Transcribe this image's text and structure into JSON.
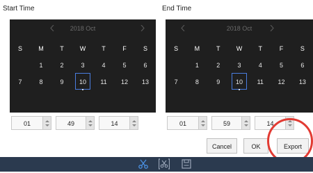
{
  "start": {
    "title": "Start Time",
    "month_label": "2018 Oct",
    "prev_icon": "chevron-left-icon",
    "next_icon": "chevron-right-icon",
    "days_of_week": [
      "S",
      "M",
      "T",
      "W",
      "T",
      "F",
      "S"
    ],
    "weeks": [
      [
        "",
        "1",
        "2",
        "3",
        "4",
        "5",
        "6"
      ],
      [
        "7",
        "8",
        "9",
        "10",
        "11",
        "12",
        "13"
      ]
    ],
    "selected_day": "10",
    "time": {
      "hour": "01",
      "minute": "49",
      "second": "14"
    }
  },
  "end": {
    "title": "End Time",
    "month_label": "2018 Oct",
    "prev_icon": "chevron-left-icon",
    "next_icon": "chevron-right-icon",
    "days_of_week": [
      "S",
      "M",
      "T",
      "W",
      "T",
      "F",
      "S"
    ],
    "weeks": [
      [
        "",
        "1",
        "2",
        "3",
        "4",
        "5",
        "6"
      ],
      [
        "7",
        "8",
        "9",
        "10",
        "11",
        "12",
        "13"
      ]
    ],
    "selected_day": "10",
    "time": {
      "hour": "01",
      "minute": "59",
      "second": "14"
    }
  },
  "buttons": {
    "cancel": "Cancel",
    "ok": "OK",
    "export": "Export"
  },
  "footer": {
    "icons": [
      "scissors-icon",
      "clip-select-icon",
      "save-icon"
    ],
    "accent": "#4a90e2"
  },
  "colors": {
    "calendar_bg": "#1f1f1f",
    "selected_border": "#4a7de0",
    "footer_bg": "#2b3a4f",
    "highlight_ring": "#e23b33"
  }
}
